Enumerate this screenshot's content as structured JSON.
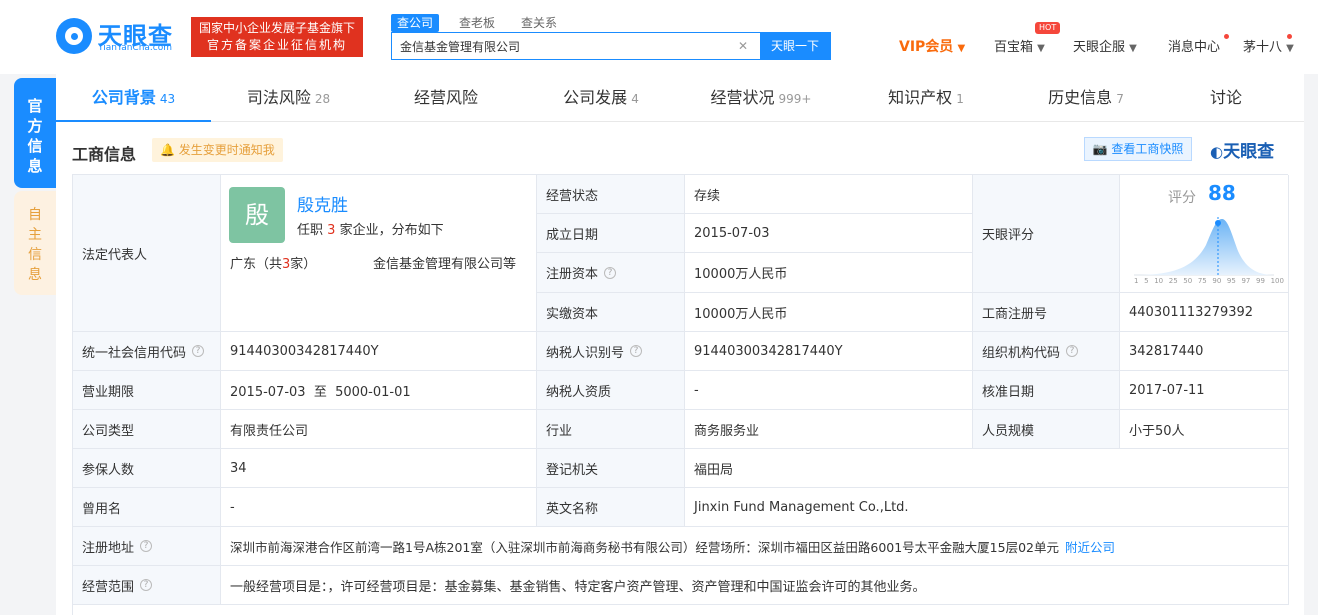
{
  "header": {
    "logo_name": "天眼查",
    "logo_domain": "TianYanCha.com",
    "badge_line1": "国家中小企业发展子基金旗下",
    "badge_line2": "官方备案企业征信机构",
    "search_tabs": [
      "查公司",
      "查老板",
      "查关系"
    ],
    "search_value": "金信基金管理有限公司",
    "search_button": "天眼一下",
    "vip": "VIP会员",
    "treasure": "百宝箱",
    "hot": "HOT",
    "enterprise": "天眼企服",
    "messages": "消息中心",
    "user": "茅十八"
  },
  "side_tabs": {
    "official": "官方信息",
    "self": "自主信息"
  },
  "tabs": [
    {
      "label": "公司背景",
      "count": "43"
    },
    {
      "label": "司法风险",
      "count": "28"
    },
    {
      "label": "经营风险",
      "count": ""
    },
    {
      "label": "公司发展",
      "count": "4"
    },
    {
      "label": "经营状况",
      "count": "999+"
    },
    {
      "label": "知识产权",
      "count": "1"
    },
    {
      "label": "历史信息",
      "count": "7"
    },
    {
      "label": "讨论",
      "count": ""
    }
  ],
  "section": {
    "title": "工商信息",
    "notify": "发生变更时通知我",
    "snapshot": "查看工商快照",
    "brand": "天眼查"
  },
  "legal_rep": {
    "label": "法定代表人",
    "avatar_char": "殷",
    "name": "殷克胜",
    "info_prefix": "任职",
    "info_count": "3",
    "info_suffix": "家企业，分布如下",
    "area_prefix": "广东（共",
    "area_count": "3",
    "area_suffix": "家）",
    "company": "金信基金管理有限公司等"
  },
  "score": {
    "label": "天眼评分",
    "title": "评分",
    "value": "88",
    "axis": [
      "1",
      "5",
      "10",
      "25",
      "50",
      "75",
      "90",
      "95",
      "97",
      "99",
      "100"
    ]
  },
  "fields": {
    "status_label": "经营状态",
    "status": "存续",
    "founded_label": "成立日期",
    "founded": "2015-07-03",
    "reg_capital_label": "注册资本",
    "reg_capital": "10000万人民币",
    "paid_capital_label": "实缴资本",
    "paid_capital": "10000万人民币",
    "reg_no_label": "工商注册号",
    "reg_no": "440301113279392",
    "credit_code_label": "统一社会信用代码",
    "credit_code": "91440300342817440Y",
    "taxpayer_id_label": "纳税人识别号",
    "taxpayer_id": "91440300342817440Y",
    "org_code_label": "组织机构代码",
    "org_code": "342817440",
    "term_label": "营业期限",
    "term": "2015-07-03  至  5000-01-01",
    "taxpayer_qual_label": "纳税人资质",
    "taxpayer_qual": "-",
    "approve_label": "核准日期",
    "approve": "2017-07-11",
    "type_label": "公司类型",
    "type": "有限责任公司",
    "industry_label": "行业",
    "industry": "商务服务业",
    "staff_label": "人员规模",
    "staff": "小于50人",
    "insured_label": "参保人数",
    "insured": "34",
    "authority_label": "登记机关",
    "authority": "福田局",
    "former_label": "曾用名",
    "former": "-",
    "english_label": "英文名称",
    "english": "Jinxin Fund Management Co.,Ltd.",
    "address_label": "注册地址",
    "address": "深圳市前海深港合作区前湾一路1号A栋201室（入驻深圳市前海商务秘书有限公司）经营场所：深圳市福田区益田路6001号太平金融大厦15层02单元",
    "nearby": "附近公司",
    "scope_label": "经营范围",
    "scope": "一般经营项目是：，许可经营项目是：基金募集、基金销售、特定客户资产管理、资产管理和中国证监会许可的其他业务。"
  }
}
